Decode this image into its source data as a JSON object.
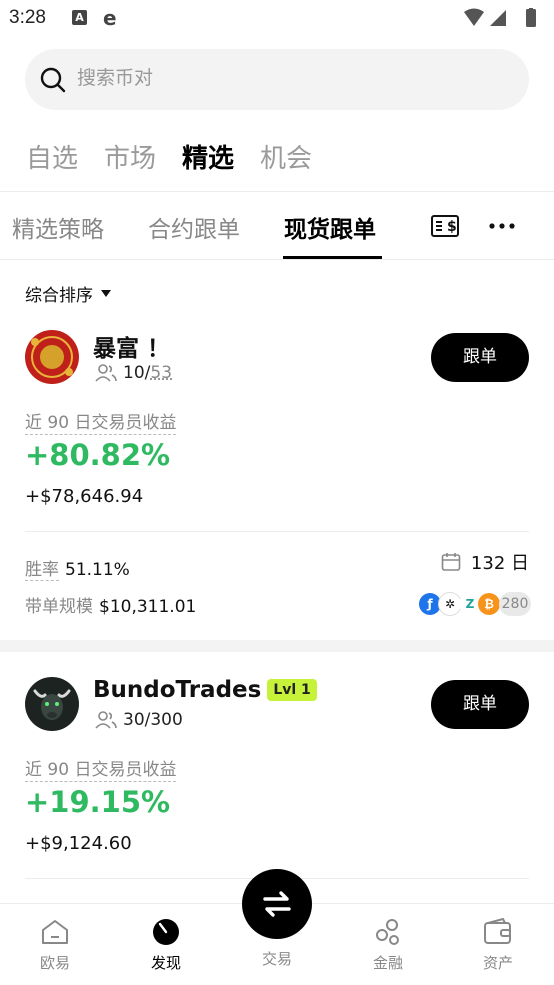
{
  "status_bar": {
    "time": "3:28"
  },
  "search": {
    "placeholder": "搜索币对"
  },
  "main_tabs": [
    "自选",
    "市场",
    "精选",
    "机会"
  ],
  "sub_tabs": [
    "精选策略",
    "合约跟单",
    "现货跟单"
  ],
  "sort": {
    "label": "综合排序"
  },
  "traders": [
    {
      "name": "暴富 ！",
      "followers": "10",
      "followers_max": "53",
      "copy_label": "跟单",
      "pnl_label": "近 90 日交易员收益",
      "pnl_pct": "+80.82%",
      "pnl_usd": "+$78,646.94",
      "win_rate_label": "胜率",
      "win_rate": "51.11%",
      "aum_label": "带单规模",
      "aum": "$10,311.01",
      "days": "132 日",
      "coin_count": "280"
    },
    {
      "name": "BundoTrades",
      "badge": "Lvl 1",
      "followers": "30/300",
      "copy_label": "跟单",
      "pnl_label": "近 90 日交易员收益",
      "pnl_pct": "+19.15%",
      "pnl_usd": "+$9,124.60"
    }
  ],
  "bottom_nav": [
    "欧易",
    "发现",
    "交易",
    "金融",
    "资产"
  ],
  "colors": {
    "profit": "#2fba62",
    "badge": "#c6f23a",
    "primary": "#000000"
  }
}
